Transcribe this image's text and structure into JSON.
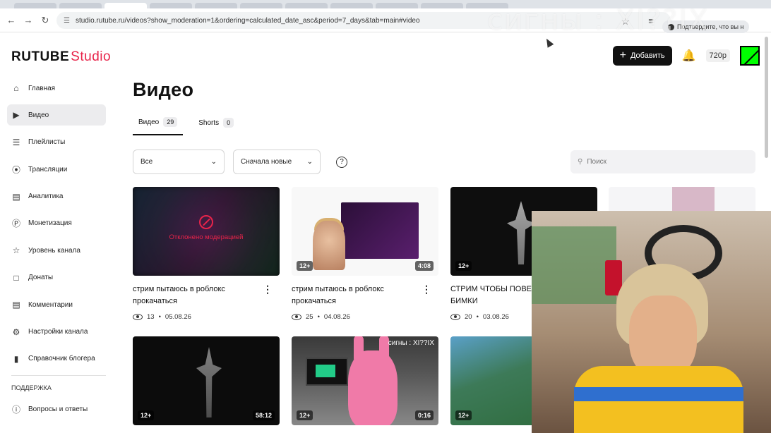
{
  "browser": {
    "url": "studio.rutube.ru/videos?show_moderation=1&ordering=calculated_date_asc&period=7_days&tab=main#video",
    "profile_label": "Подтвердите, что вы н",
    "watermark": "сигны : XI??IX"
  },
  "header": {
    "logo_brand": "RUTUBE",
    "logo_product": "Studio",
    "add_label": "Добавить",
    "quality_label": "720p"
  },
  "sidebar": {
    "items": [
      {
        "label": "Главная",
        "icon": "home-icon"
      },
      {
        "label": "Видео",
        "icon": "video-icon"
      },
      {
        "label": "Плейлисты",
        "icon": "playlist-icon"
      },
      {
        "label": "Трансляции",
        "icon": "broadcast-icon"
      },
      {
        "label": "Аналитика",
        "icon": "analytics-icon"
      },
      {
        "label": "Монетизация",
        "icon": "monetization-icon"
      },
      {
        "label": "Уровень канала",
        "icon": "star-icon"
      },
      {
        "label": "Донаты",
        "icon": "donations-icon"
      },
      {
        "label": "Комментарии",
        "icon": "comments-icon"
      },
      {
        "label": "Настройки канала",
        "icon": "settings-icon"
      },
      {
        "label": "Справочник блогера",
        "icon": "book-icon"
      }
    ],
    "support_caption": "ПОДДЕРЖКА",
    "faq_label": "Вопросы и ответы"
  },
  "main": {
    "title": "Видео",
    "tabs": [
      {
        "label": "Видео",
        "count": "29"
      },
      {
        "label": "Shorts",
        "count": "0"
      }
    ],
    "filter_label": "Все",
    "sort_label": "Сначала новые",
    "help_label": "?",
    "search_placeholder": "Поиск"
  },
  "videos": [
    {
      "title": "стрим пытаюсь в роблокс прокачаться",
      "views": "13",
      "date": "05.08.26",
      "age": "",
      "duration": "",
      "status": "Отклонено модерацией"
    },
    {
      "title": "стрим пытаюсь в роблокс прокачаться",
      "views": "25",
      "date": "04.08.26",
      "age": "12+",
      "duration": "4:08",
      "status": ""
    },
    {
      "title": "СТРИМ ЧТОБЫ ПОВЕС В ИГРЫ БИМКИ",
      "views": "20",
      "date": "03.08.26",
      "age": "12+",
      "duration": "",
      "status": ""
    },
    {
      "title": "",
      "views": "",
      "date": "",
      "age": "12+",
      "duration": "58:12",
      "status": ""
    },
    {
      "title": "",
      "views": "",
      "date": "",
      "age": "12+",
      "duration": "0:16",
      "status": ""
    },
    {
      "title": "",
      "views": "",
      "date": "",
      "age": "12+",
      "duration": "",
      "status": ""
    }
  ],
  "thumb_captions": {
    "second_row_mid": "сигны : XI??IX"
  }
}
